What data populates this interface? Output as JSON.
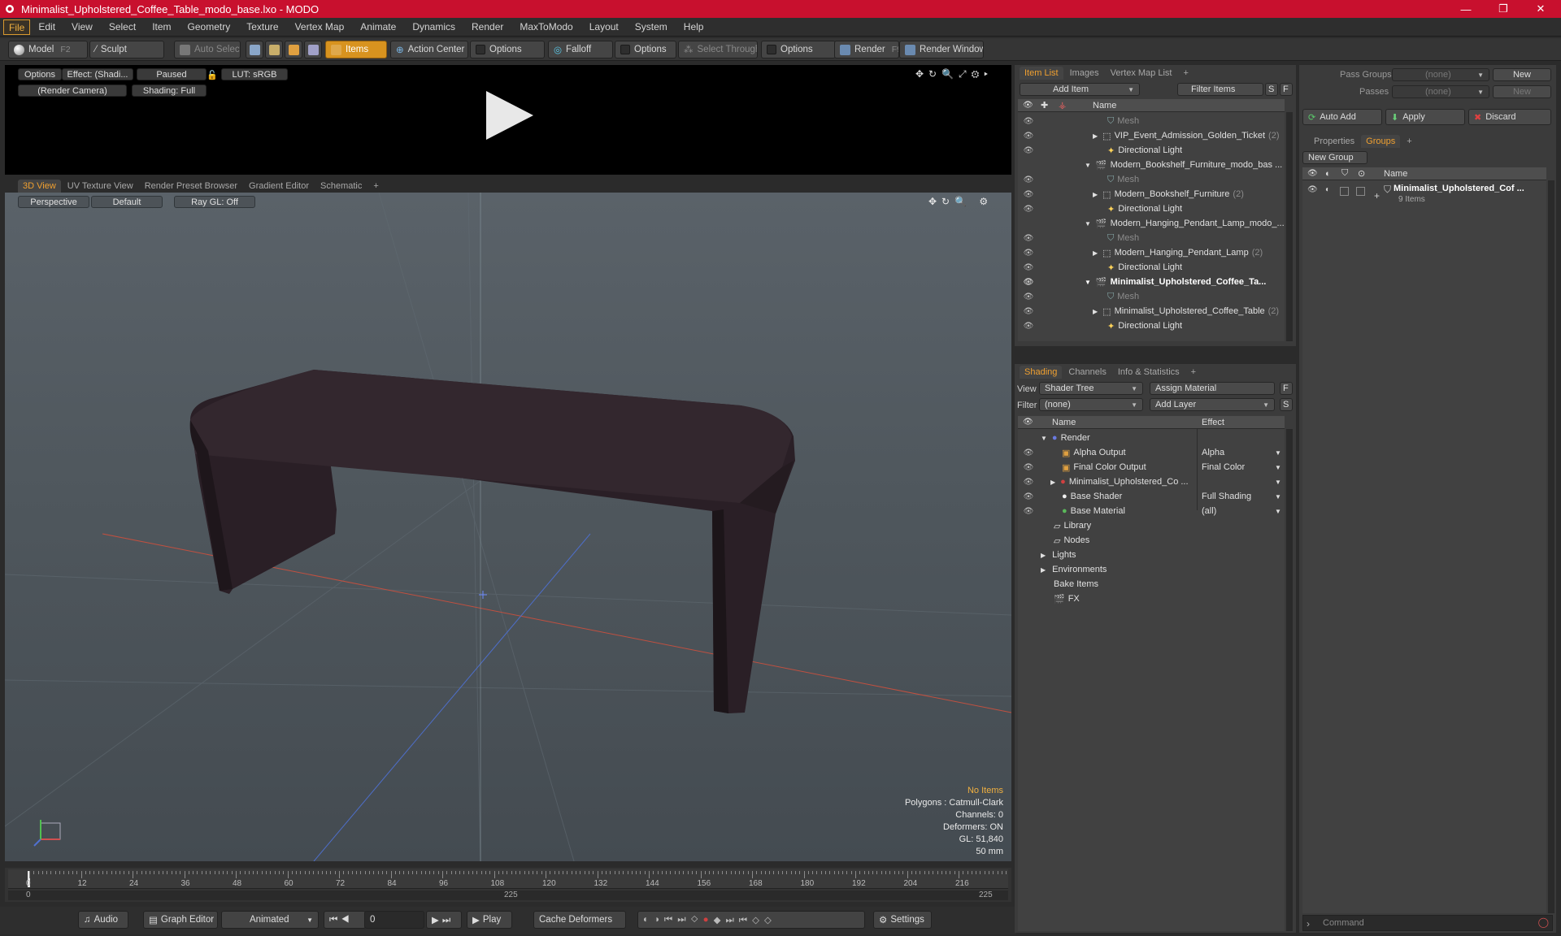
{
  "window": {
    "title": "Minimalist_Upholstered_Coffee_Table_modo_base.lxo - MODO"
  },
  "menu": [
    "File",
    "Edit",
    "View",
    "Select",
    "Item",
    "Geometry",
    "Texture",
    "Vertex Map",
    "Animate",
    "Dynamics",
    "Render",
    "MaxToModo",
    "Layout",
    "System",
    "Help"
  ],
  "toolbar": {
    "model": "Model",
    "model_key": "F2",
    "sculpt": "Sculpt",
    "auto_select": "Auto Select",
    "items": "Items",
    "action_center": "Action Center",
    "options1": "Options",
    "falloff": "Falloff",
    "options2": "Options",
    "select_through": "Select Through",
    "options3": "Options",
    "render": "Render",
    "render_key": "F9",
    "render_window": "Render Window"
  },
  "render_preview": {
    "options": "Options",
    "effect": "Effect: (Shadi...",
    "paused": "Paused",
    "lut": "LUT: sRGB",
    "camera": "(Render Camera)",
    "shading": "Shading: Full"
  },
  "view_tabs": [
    "3D View",
    "UV Texture View",
    "Render Preset Browser",
    "Gradient Editor",
    "Schematic"
  ],
  "view3d": {
    "perspective": "Perspective",
    "default": "Default",
    "raygl": "Ray GL: Off",
    "stats": [
      "No Items",
      "Polygons : Catmull-Clark",
      "Channels: 0",
      "Deformers: ON",
      "GL: 51,840",
      "50 mm"
    ]
  },
  "timeline": {
    "ticks": [
      "0",
      "12",
      "24",
      "36",
      "48",
      "60",
      "72",
      "84",
      "96",
      "108",
      "120",
      "132",
      "144",
      "156",
      "168",
      "180",
      "192",
      "204",
      "216"
    ],
    "start": "0",
    "mid": "225",
    "end": "225"
  },
  "bottom": {
    "audio": "Audio",
    "graph_editor": "Graph Editor",
    "animated": "Animated",
    "frame": "0",
    "play": "Play",
    "cache_deformers": "Cache Deformers",
    "settings": "Settings"
  },
  "item_list": {
    "tabs": [
      "Item List",
      "Images",
      "Vertex Map List"
    ],
    "add_item": "Add Item",
    "filter_items": "Filter Items",
    "s": "S",
    "f": "F",
    "col_name": "Name",
    "rows": [
      {
        "label": "Mesh",
        "count": ""
      },
      {
        "label": "VIP_Event_Admission_Golden_Ticket",
        "count": "(2)"
      },
      {
        "label": "Directional Light",
        "count": ""
      },
      {
        "label": "Modern_Bookshelf_Furniture_modo_bas ...",
        "count": ""
      },
      {
        "label": "Mesh",
        "count": ""
      },
      {
        "label": "Modern_Bookshelf_Furniture",
        "count": "(2)"
      },
      {
        "label": "Directional Light",
        "count": ""
      },
      {
        "label": "Modern_Hanging_Pendant_Lamp_modo_...",
        "count": ""
      },
      {
        "label": "Mesh",
        "count": ""
      },
      {
        "label": "Modern_Hanging_Pendant_Lamp",
        "count": "(2)"
      },
      {
        "label": "Directional Light",
        "count": ""
      },
      {
        "label": "Minimalist_Upholstered_Coffee_Ta...",
        "count": ""
      },
      {
        "label": "Mesh",
        "count": ""
      },
      {
        "label": "Minimalist_Upholstered_Coffee_Table",
        "count": "(2)"
      },
      {
        "label": "Directional Light",
        "count": ""
      }
    ]
  },
  "shading": {
    "tabs": [
      "Shading",
      "Channels",
      "Info & Statistics"
    ],
    "view_label": "View",
    "view_value": "Shader Tree",
    "assign_material": "Assign Material",
    "f": "F",
    "filter_label": "Filter",
    "filter_value": "(none)",
    "add_layer": "Add Layer",
    "s": "S",
    "col_name": "Name",
    "col_effect": "Effect",
    "rows": [
      {
        "label": "Render",
        "effect": ""
      },
      {
        "label": "Alpha Output",
        "effect": "Alpha"
      },
      {
        "label": "Final Color Output",
        "effect": "Final Color"
      },
      {
        "label": "Minimalist_Upholstered_Co ...",
        "effect": ""
      },
      {
        "label": "Base Shader",
        "effect": "Full Shading"
      },
      {
        "label": "Base Material",
        "effect": "(all)"
      },
      {
        "label": "Library",
        "effect": ""
      },
      {
        "label": "Nodes",
        "effect": ""
      },
      {
        "label": "Lights",
        "effect": ""
      },
      {
        "label": "Environments",
        "effect": ""
      },
      {
        "label": "Bake Items",
        "effect": ""
      },
      {
        "label": "FX",
        "effect": ""
      }
    ]
  },
  "groups": {
    "pass_groups": "Pass Groups",
    "pass_groups_value": "(none)",
    "new1": "New",
    "passes": "Passes",
    "passes_value": "(none)",
    "new2": "New",
    "auto_add": "Auto Add",
    "apply": "Apply",
    "discard": "Discard",
    "tabs": [
      "Properties",
      "Groups"
    ],
    "new_group": "New Group",
    "col_name": "Name",
    "group_name": "Minimalist_Upholstered_Cof ...",
    "group_count": "9 Items",
    "command": "Command"
  }
}
